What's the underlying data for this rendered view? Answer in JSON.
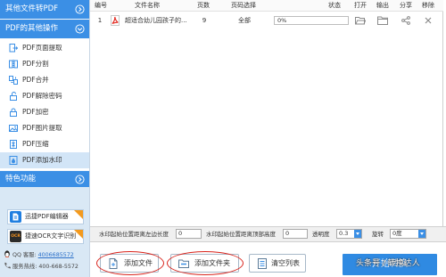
{
  "colors": {
    "accent": "#3b8fe5",
    "sidebar_selected": "#d2e5f7",
    "promo_bg": "#d9e8f5",
    "start_button": "#2f8ae2",
    "pdf_red": "#e2231a",
    "annotation": "#d9231b",
    "link": "#2a6fc9"
  },
  "sidebar": {
    "convert_header": {
      "label": "其他文件转PDF",
      "icon": "chevron-right-circle-icon"
    },
    "other_ops_header": {
      "label": "PDF的其他操作",
      "icon": "chevron-down-circle-icon"
    },
    "items": [
      {
        "label": "PDF页面提取",
        "icon": "page-extract-icon",
        "selected": false
      },
      {
        "label": "PDF分割",
        "icon": "split-icon",
        "selected": false
      },
      {
        "label": "PDF合并",
        "icon": "merge-icon",
        "selected": false
      },
      {
        "label": "PDF解除密码",
        "icon": "unlock-icon",
        "selected": false
      },
      {
        "label": "PDF加密",
        "icon": "lock-icon",
        "selected": false
      },
      {
        "label": "PDF图片提取",
        "icon": "image-extract-icon",
        "selected": false
      },
      {
        "label": "PDF压缩",
        "icon": "compress-icon",
        "selected": false
      },
      {
        "label": "PDF添加水印",
        "icon": "watermark-icon",
        "selected": true
      }
    ],
    "featured_header": {
      "label": "特色功能",
      "icon": "chevron-right-circle-icon"
    },
    "promos": [
      {
        "label": "迅捷PDF编辑器",
        "icon": "pdf-editor-icon"
      },
      {
        "label": "捷速OCR文字识别",
        "icon": "ocr-icon",
        "logo_text": "OCR"
      }
    ],
    "contact": {
      "qq_label": "QQ 客服:",
      "qq_number": "4006685572",
      "hotline_label": "服务热线:",
      "hotline_number": "400-668-5572"
    }
  },
  "file_table": {
    "columns": [
      "编号",
      "文件名称",
      "页数",
      "页码选择",
      "状态",
      "打开",
      "输出",
      "分享",
      "移除"
    ],
    "rows": [
      {
        "index": "1",
        "icon": "pdf-file-icon",
        "name": "超适合幼儿园孩子的...",
        "pages": "9",
        "page_range": "全部",
        "progress": 0,
        "progress_label": "0%",
        "open_icon": "folder-open-icon",
        "output_icon": "folder-icon",
        "share_icon": "share-icon",
        "remove_icon": "remove-icon"
      }
    ]
  },
  "watermark_settings": {
    "left_label": "水印起始位置距离左边长度",
    "left_value": "0",
    "top_label": "水印起始位置距离顶部高度",
    "top_value": "0",
    "opacity_label": "透明度",
    "opacity_value": "0.3",
    "rotate_label": "旋转",
    "rotate_value": "0度"
  },
  "actions": {
    "add_file": {
      "label": "添加文件",
      "icon": "add-file-icon"
    },
    "add_folder": {
      "label": "添加文件夹",
      "icon": "add-folder-icon"
    },
    "clear_list": {
      "label": "清空列表",
      "icon": "clear-list-icon"
    },
    "start": {
      "label": "开始转换"
    }
  },
  "overlay_watermark": "头条号 / 转换达人"
}
